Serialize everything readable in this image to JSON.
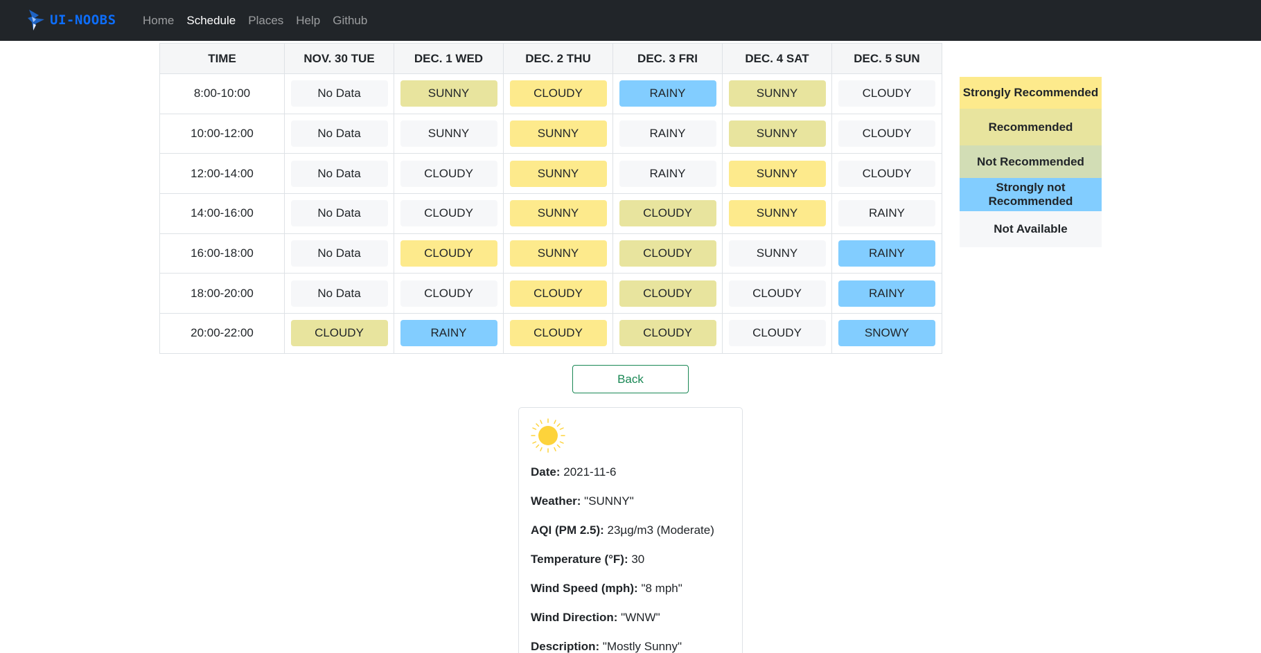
{
  "nav": {
    "brand": "UI-NOOBS",
    "links": [
      "Home",
      "Schedule",
      "Places",
      "Help",
      "Github"
    ],
    "active": "Schedule"
  },
  "table": {
    "headers": [
      "TIME",
      "NOV. 30 TUE",
      "DEC. 1 WED",
      "DEC. 2 THU",
      "DEC. 3 FRI",
      "DEC. 4 SAT",
      "DEC. 5 SUN"
    ],
    "rows": [
      {
        "time": "8:00-10:00",
        "cells": [
          {
            "text": "No Data",
            "level": "na"
          },
          {
            "text": "SUNNY",
            "level": "rec"
          },
          {
            "text": "CLOUDY",
            "level": "strong"
          },
          {
            "text": "RAINY",
            "level": "strongnot"
          },
          {
            "text": "SUNNY",
            "level": "rec"
          },
          {
            "text": "CLOUDY",
            "level": "na"
          }
        ]
      },
      {
        "time": "10:00-12:00",
        "cells": [
          {
            "text": "No Data",
            "level": "na"
          },
          {
            "text": "SUNNY",
            "level": "na"
          },
          {
            "text": "SUNNY",
            "level": "strong"
          },
          {
            "text": "RAINY",
            "level": "na"
          },
          {
            "text": "SUNNY",
            "level": "rec"
          },
          {
            "text": "CLOUDY",
            "level": "na"
          }
        ]
      },
      {
        "time": "12:00-14:00",
        "cells": [
          {
            "text": "No Data",
            "level": "na"
          },
          {
            "text": "CLOUDY",
            "level": "na"
          },
          {
            "text": "SUNNY",
            "level": "strong"
          },
          {
            "text": "RAINY",
            "level": "na"
          },
          {
            "text": "SUNNY",
            "level": "strong"
          },
          {
            "text": "CLOUDY",
            "level": "na"
          }
        ]
      },
      {
        "time": "14:00-16:00",
        "cells": [
          {
            "text": "No Data",
            "level": "na"
          },
          {
            "text": "CLOUDY",
            "level": "na"
          },
          {
            "text": "SUNNY",
            "level": "strong"
          },
          {
            "text": "CLOUDY",
            "level": "rec"
          },
          {
            "text": "SUNNY",
            "level": "strong"
          },
          {
            "text": "RAINY",
            "level": "na"
          }
        ]
      },
      {
        "time": "16:00-18:00",
        "cells": [
          {
            "text": "No Data",
            "level": "na"
          },
          {
            "text": "CLOUDY",
            "level": "strong"
          },
          {
            "text": "SUNNY",
            "level": "strong"
          },
          {
            "text": "CLOUDY",
            "level": "rec"
          },
          {
            "text": "SUNNY",
            "level": "na"
          },
          {
            "text": "RAINY",
            "level": "strongnot"
          }
        ]
      },
      {
        "time": "18:00-20:00",
        "cells": [
          {
            "text": "No Data",
            "level": "na"
          },
          {
            "text": "CLOUDY",
            "level": "na"
          },
          {
            "text": "CLOUDY",
            "level": "strong"
          },
          {
            "text": "CLOUDY",
            "level": "rec"
          },
          {
            "text": "CLOUDY",
            "level": "na"
          },
          {
            "text": "RAINY",
            "level": "strongnot"
          }
        ]
      },
      {
        "time": "20:00-22:00",
        "cells": [
          {
            "text": "CLOUDY",
            "level": "rec"
          },
          {
            "text": "RAINY",
            "level": "strongnot"
          },
          {
            "text": "CLOUDY",
            "level": "strong"
          },
          {
            "text": "CLOUDY",
            "level": "rec"
          },
          {
            "text": "CLOUDY",
            "level": "na"
          },
          {
            "text": "SNOWY",
            "level": "strongnot"
          }
        ]
      }
    ]
  },
  "legend": [
    {
      "label": "Strongly Recommended",
      "level": "strong"
    },
    {
      "label": "Recommended",
      "level": "rec"
    },
    {
      "label": "Not Recommended",
      "level": "notrec"
    },
    {
      "label": "Strongly not Recommended",
      "level": "strongnot"
    },
    {
      "label": "Not Available",
      "level": "na"
    }
  ],
  "colors": {
    "strong": "#fdea8c",
    "rec": "#e8e49e",
    "notrec": "#d2ddb5",
    "strongnot": "#82cdff",
    "na": "#f6f7f9",
    "navbar": "#212529",
    "brand": "#0d6efd",
    "back_button": "#198754"
  },
  "back_button": "Back",
  "details": {
    "icon": "sun-icon",
    "items": [
      {
        "label": "Date:",
        "value": " 2021-11-6"
      },
      {
        "label": "Weather:",
        "value": " \"SUNNY\""
      },
      {
        "label": "AQI (PM 2.5):",
        "value": " 23µg/m3 (Moderate)"
      },
      {
        "label": "Temperature (°F):",
        "value": " 30"
      },
      {
        "label": "Wind Speed (mph):",
        "value": " \"8 mph\""
      },
      {
        "label": "Wind Direction:",
        "value": " \"WNW\""
      },
      {
        "label": "Description:",
        "value": " \"Mostly Sunny\""
      }
    ]
  }
}
